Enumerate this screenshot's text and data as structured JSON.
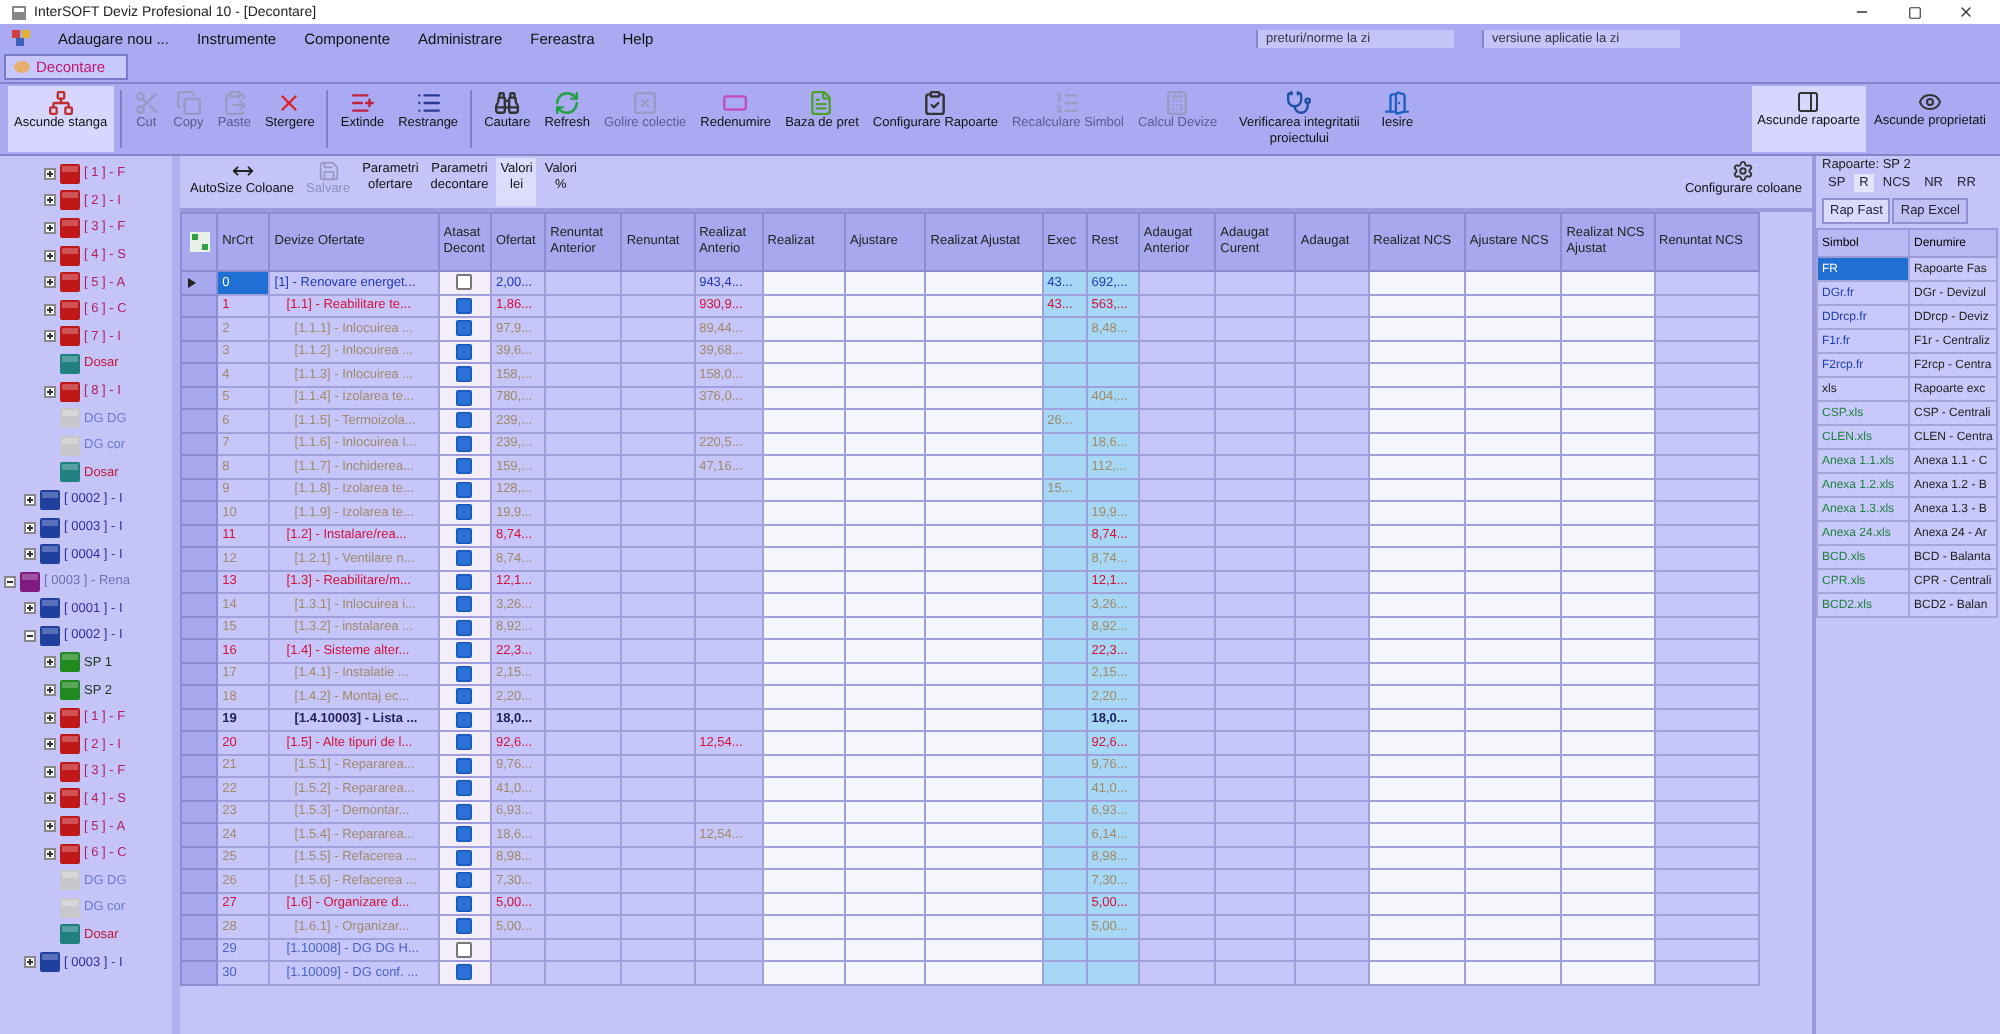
{
  "window": {
    "title": "InterSOFT Deviz Profesional 10 - [Decontare]"
  },
  "menu": [
    "Adaugare nou ...",
    "Instrumente",
    "Componente",
    "Administrare",
    "Fereastra",
    "Help"
  ],
  "menu_fields": [
    "preturi/norme la zi",
    "versiune aplicatie la zi"
  ],
  "document_tab": {
    "label": "Decontare",
    "selected": true
  },
  "toolbar": [
    {
      "label": "Ascunde stanga",
      "disabled": false,
      "on": true
    },
    {
      "label": "Cut",
      "disabled": true,
      "on": false
    },
    {
      "label": "Copy",
      "disabled": true,
      "on": false
    },
    {
      "label": "Paste",
      "disabled": true,
      "on": false
    },
    {
      "label": "Stergere",
      "disabled": false,
      "on": false
    },
    {
      "label": "Extinde",
      "disabled": false,
      "on": false
    },
    {
      "label": "Restrange",
      "disabled": false,
      "on": false
    },
    {
      "label": "Cautare",
      "disabled": false,
      "on": false
    },
    {
      "label": "Refresh",
      "disabled": false,
      "on": false
    },
    {
      "label": "Golire colectie",
      "disabled": true,
      "on": false
    },
    {
      "label": "Redenumire",
      "disabled": false,
      "on": false
    },
    {
      "label": "Baza de pret",
      "disabled": false,
      "on": false
    },
    {
      "label": "Configurare Rapoarte",
      "disabled": false,
      "on": false
    },
    {
      "label": "Recalculare Simbol",
      "disabled": true,
      "on": false
    },
    {
      "label": "Calcul Devize",
      "disabled": true,
      "on": false
    },
    {
      "label": "Verificarea integritatii proiectului",
      "disabled": false,
      "on": false
    },
    {
      "label": "Iesire",
      "disabled": false,
      "on": false
    }
  ],
  "toolbar_right": [
    {
      "label": "Ascunde rapoarte",
      "on": true
    },
    {
      "label": "Ascunde proprietati",
      "on": false
    }
  ],
  "tree": [
    {
      "children": [
        {
          "children": [
            {
              "label": "[ 1 ] - F",
              "kind": "chapter",
              "expanded": false
            },
            {
              "label": "[ 2 ] - I",
              "kind": "chapter",
              "expanded": false
            },
            {
              "label": "[ 3 ] - F",
              "kind": "chapter",
              "expanded": false
            },
            {
              "label": "[ 4 ] - S",
              "kind": "chapter",
              "expanded": false
            },
            {
              "label": "[ 5 ] - A",
              "kind": "chapter",
              "expanded": false
            },
            {
              "label": "[ 6 ] - C",
              "kind": "chapter",
              "expanded": false
            },
            {
              "label": "[ 7 ] - I",
              "kind": "chapter",
              "expanded": false
            },
            {
              "label": "Dosar",
              "kind": "dosar"
            },
            {
              "label": "[ 8 ] - I",
              "kind": "chapter",
              "expanded": false
            },
            {
              "label": "DG DG",
              "kind": "dg"
            },
            {
              "label": "DG cor",
              "kind": "dg"
            },
            {
              "label": "Dosar",
              "kind": "dosar"
            }
          ]
        },
        {
          "label": "[ 0002 ] - I",
          "kind": "object",
          "expanded": false
        },
        {
          "label": "[ 0003 ] - I",
          "kind": "object",
          "expanded": false
        },
        {
          "label": "[ 0004 ] - I",
          "kind": "object",
          "expanded": false
        }
      ]
    },
    {
      "label": "[ 0003 ] - Rena",
      "kind": "project",
      "expanded": true,
      "children": [
        {
          "label": "[ 0001 ] - I",
          "kind": "object",
          "expanded": false
        },
        {
          "label": "[ 0002 ] - I",
          "kind": "object",
          "expanded": true,
          "children": [
            {
              "label": "SP 1",
              "kind": "sp",
              "expanded": false
            },
            {
              "label": "SP 2",
              "kind": "sp",
              "expanded": false
            },
            {
              "label": "[ 1 ] - F",
              "kind": "chapter",
              "expanded": false
            },
            {
              "label": "[ 2 ] - I",
              "kind": "chapter",
              "expanded": false
            },
            {
              "label": "[ 3 ] - F",
              "kind": "chapter",
              "expanded": false
            },
            {
              "label": "[ 4 ] - S",
              "kind": "chapter",
              "expanded": false
            },
            {
              "label": "[ 5 ] - A",
              "kind": "chapter",
              "expanded": false
            },
            {
              "label": "[ 6 ] - C",
              "kind": "chapter",
              "expanded": false
            },
            {
              "label": "DG DG",
              "kind": "dg"
            },
            {
              "label": "DG cor",
              "kind": "dg"
            },
            {
              "label": "Dosar",
              "kind": "dosar"
            }
          ]
        },
        {
          "label": "[ 0003 ] - I",
          "kind": "object",
          "expanded": false
        }
      ]
    }
  ],
  "grid_toolbar": [
    {
      "label": "AutoSize Coloane",
      "kind": "button",
      "disabled": false
    },
    {
      "label": "Salvare",
      "kind": "button",
      "disabled": true
    },
    {
      "label": "Parametri ofertare",
      "kind": "toggle",
      "selected": false
    },
    {
      "label": "Parametri decontare",
      "kind": "toggle",
      "selected": false
    },
    {
      "label": "Valori lei",
      "kind": "toggle",
      "selected": true
    },
    {
      "label": "Valori %",
      "kind": "toggle",
      "selected": false
    }
  ],
  "configure_columns": "Configurare coloane",
  "table": {
    "columns": [
      {
        "label": "NrCrt",
        "kind": "text"
      },
      {
        "label": "Devize Ofertate",
        "kind": "text"
      },
      {
        "label": "Atasat Decont",
        "kind": "check"
      },
      {
        "label": "Ofertat",
        "kind": "text"
      },
      {
        "label": "Renuntat Anterior",
        "kind": "text"
      },
      {
        "label": "Renuntat",
        "kind": "text"
      },
      {
        "label": "Realizat Anterio",
        "kind": "text"
      },
      {
        "label": "Realizat",
        "kind": "input"
      },
      {
        "label": "Ajustare",
        "kind": "input"
      },
      {
        "label": "Realizat Ajustat",
        "kind": "input"
      },
      {
        "label": "Exec",
        "kind": "calc"
      },
      {
        "label": "Rest",
        "kind": "calc"
      },
      {
        "label": "Adaugat Anterior",
        "kind": "text"
      },
      {
        "label": "Adaugat Curent",
        "kind": "text"
      },
      {
        "label": "Adaugat",
        "kind": "text"
      },
      {
        "label": "Realizat NCS",
        "kind": "input"
      },
      {
        "label": "Ajustare NCS",
        "kind": "input"
      },
      {
        "label": "Realizat NCS Ajustat",
        "kind": "input"
      },
      {
        "label": "Renuntat NCS",
        "kind": "text"
      }
    ],
    "rows": [
      {
        "nr": "0",
        "name": "[1] - Renovare energet...",
        "kind": "root",
        "selected": true,
        "attached": false,
        "ofertat": "2,00...",
        "realizat_anterior": "943,4...",
        "exec": "43...",
        "rest": "692,..."
      },
      {
        "nr": "1",
        "name": "[1.1] - Reabilitare te...",
        "kind": "group",
        "selected": false,
        "attached": true,
        "ofertat": "1,86...",
        "realizat_anterior": "930,9...",
        "exec": "43...",
        "rest": "563,..."
      },
      {
        "nr": "2",
        "name": "[1.1.1] - Inlocuirea ...",
        "kind": "item",
        "selected": false,
        "attached": true,
        "ofertat": "97,9...",
        "realizat_anterior": "89,44...",
        "rest": "8,48..."
      },
      {
        "nr": "3",
        "name": "[1.1.2] - Inlocuirea ...",
        "kind": "item",
        "selected": false,
        "attached": true,
        "ofertat": "39,6...",
        "realizat_anterior": "39,68..."
      },
      {
        "nr": "4",
        "name": "[1.1.3] - Inlocuirea ...",
        "kind": "item",
        "selected": false,
        "attached": true,
        "ofertat": "158,...",
        "realizat_anterior": "158,0..."
      },
      {
        "nr": "5",
        "name": "[1.1.4] - Izolarea te...",
        "kind": "item",
        "selected": false,
        "attached": true,
        "ofertat": "780,...",
        "realizat_anterior": "376,0...",
        "rest": "404,..."
      },
      {
        "nr": "6",
        "name": "[1.1.5] - Termoizola...",
        "kind": "item",
        "selected": false,
        "attached": true,
        "ofertat": "239,...",
        "exec": "26..."
      },
      {
        "nr": "7",
        "name": "[1.1.6] - Inlocuirea I...",
        "kind": "item",
        "selected": false,
        "attached": true,
        "ofertat": "239,...",
        "realizat_anterior": "220,5...",
        "rest": "18,6..."
      },
      {
        "nr": "8",
        "name": "[1.1.7] - Inchiderea...",
        "kind": "item",
        "selected": false,
        "attached": true,
        "ofertat": "159,...",
        "realizat_anterior": "47,16...",
        "rest": "112,..."
      },
      {
        "nr": "9",
        "name": "[1.1.8] - Izolarea te...",
        "kind": "item",
        "selected": false,
        "attached": true,
        "ofertat": "128,...",
        "exec": "15..."
      },
      {
        "nr": "10",
        "name": "[1.1.9] - Izolarea te...",
        "kind": "item",
        "selected": false,
        "attached": true,
        "ofertat": "19,9...",
        "rest": "19,9..."
      },
      {
        "nr": "11",
        "name": "[1.2] - Instalare/rea...",
        "kind": "group",
        "selected": false,
        "attached": true,
        "ofertat": "8,74...",
        "rest": "8,74..."
      },
      {
        "nr": "12",
        "name": "[1.2.1] - Ventilare n...",
        "kind": "item",
        "selected": false,
        "attached": true,
        "ofertat": "8,74...",
        "rest": "8,74..."
      },
      {
        "nr": "13",
        "name": "[1.3] - Reabilitare/m...",
        "kind": "group",
        "selected": false,
        "attached": true,
        "ofertat": "12,1...",
        "rest": "12,1..."
      },
      {
        "nr": "14",
        "name": "[1.3.1] - Inlocuirea i...",
        "kind": "item",
        "selected": false,
        "attached": true,
        "ofertat": "3,26...",
        "rest": "3,26..."
      },
      {
        "nr": "15",
        "name": "[1.3.2] - instalarea ...",
        "kind": "item",
        "selected": false,
        "attached": true,
        "ofertat": "8,92...",
        "rest": "8,92..."
      },
      {
        "nr": "16",
        "name": "[1.4] - Sisteme alter...",
        "kind": "group",
        "selected": false,
        "attached": true,
        "ofertat": "22,3...",
        "rest": "22,3..."
      },
      {
        "nr": "17",
        "name": "[1.4.1] - Instalatie ...",
        "kind": "item",
        "selected": false,
        "attached": true,
        "ofertat": "2,15...",
        "rest": "2,15..."
      },
      {
        "nr": "18",
        "name": "[1.4.2] - Montaj ec...",
        "kind": "item",
        "selected": false,
        "attached": true,
        "ofertat": "2,20...",
        "rest": "2,20..."
      },
      {
        "nr": "19",
        "name": "[1.4.10003] - Lista ...",
        "kind": "list",
        "selected": false,
        "attached": true,
        "ofertat": "18,0...",
        "rest": "18,0..."
      },
      {
        "nr": "20",
        "name": "[1.5] - Alte tipuri de l...",
        "kind": "group",
        "selected": false,
        "attached": true,
        "ofertat": "92,6...",
        "realizat_anterior": "12,54...",
        "rest": "92,6..."
      },
      {
        "nr": "21",
        "name": "[1.5.1] - Repararea...",
        "kind": "item",
        "selected": false,
        "attached": true,
        "ofertat": "9,76...",
        "rest": "9,76..."
      },
      {
        "nr": "22",
        "name": "[1.5.2] - Repararea...",
        "kind": "item",
        "selected": false,
        "attached": true,
        "ofertat": "41,0...",
        "rest": "41,0..."
      },
      {
        "nr": "23",
        "name": "[1.5.3] - Demontar...",
        "kind": "item",
        "selected": false,
        "attached": true,
        "ofertat": "6,93...",
        "rest": "6,93..."
      },
      {
        "nr": "24",
        "name": "[1.5.4] - Repararea...",
        "kind": "item",
        "selected": false,
        "attached": true,
        "ofertat": "18,6...",
        "realizat_anterior": "12,54...",
        "rest": "6,14..."
      },
      {
        "nr": "25",
        "name": "[1.5.5] - Refacerea ...",
        "kind": "item",
        "selected": false,
        "attached": true,
        "ofertat": "8,98...",
        "rest": "8,98..."
      },
      {
        "nr": "26",
        "name": "[1.5.6] - Refacerea ...",
        "kind": "item",
        "selected": false,
        "attached": true,
        "ofertat": "7,30...",
        "rest": "7,30..."
      },
      {
        "nr": "27",
        "name": "[1.6] - Organizare d...",
        "kind": "group",
        "selected": false,
        "attached": true,
        "ofertat": "5,00...",
        "rest": "5,00..."
      },
      {
        "nr": "28",
        "name": "[1.6.1] - Organizar...",
        "kind": "item",
        "selected": false,
        "attached": true,
        "ofertat": "5,00...",
        "rest": "5,00..."
      },
      {
        "nr": "29",
        "name": "[1.10008] - DG DG H...",
        "kind": "dg",
        "selected": false,
        "attached": false
      },
      {
        "nr": "30",
        "name": "[1.10009] - DG conf. ...",
        "kind": "dg",
        "selected": false,
        "attached": true
      }
    ]
  },
  "reports": {
    "title": "Rapoarte: SP 2",
    "tabs": [
      {
        "label": "SP",
        "selected": false
      },
      {
        "label": "R",
        "selected": true
      },
      {
        "label": "NCS",
        "selected": false
      },
      {
        "label": "NR",
        "selected": false
      },
      {
        "label": "RR",
        "selected": false
      }
    ],
    "subtabs": [
      {
        "label": "Rap Fast",
        "selected": true
      },
      {
        "label": "Rap Excel",
        "selected": false
      }
    ],
    "columns": [
      "Simbol",
      "Denumire"
    ],
    "rows": [
      {
        "symbol": "FR",
        "name": "Rapoarte Fas",
        "kind": "group",
        "selected": true
      },
      {
        "symbol": "DGr.fr",
        "name": "DGr - Devizul",
        "kind": "fr",
        "selected": false
      },
      {
        "symbol": "DDrcp.fr",
        "name": "DDrcp - Deviz",
        "kind": "fr",
        "selected": false
      },
      {
        "symbol": "F1r.fr",
        "name": "F1r - Centraliz",
        "kind": "fr",
        "selected": false
      },
      {
        "symbol": "F2rcp.fr",
        "name": "F2rcp - Centra",
        "kind": "fr",
        "selected": false
      },
      {
        "symbol": "xls",
        "name": "Rapoarte exc",
        "kind": "group",
        "selected": false
      },
      {
        "symbol": "CSP.xls",
        "name": "CSP - Centrali",
        "kind": "xls",
        "selected": false
      },
      {
        "symbol": "CLEN.xls",
        "name": "CLEN - Centra",
        "kind": "xls",
        "selected": false
      },
      {
        "symbol": "Anexa 1.1.xls",
        "name": "Anexa 1.1 - C",
        "kind": "xls",
        "selected": false
      },
      {
        "symbol": "Anexa 1.2.xls",
        "name": "Anexa 1.2 - B",
        "kind": "xls",
        "selected": false
      },
      {
        "symbol": "Anexa 1.3.xls",
        "name": "Anexa 1.3 - B",
        "kind": "xls",
        "selected": false
      },
      {
        "symbol": "Anexa 24.xls",
        "name": "Anexa 24 - Ar",
        "kind": "xls",
        "selected": false
      },
      {
        "symbol": "BCD.xls",
        "name": "BCD - Balanta",
        "kind": "xls",
        "selected": false
      },
      {
        "symbol": "CPR.xls",
        "name": "CPR - Centrali",
        "kind": "xls",
        "selected": false
      },
      {
        "symbol": "BCD2.xls",
        "name": "BCD2 - Balan",
        "kind": "xls",
        "selected": false
      }
    ]
  }
}
